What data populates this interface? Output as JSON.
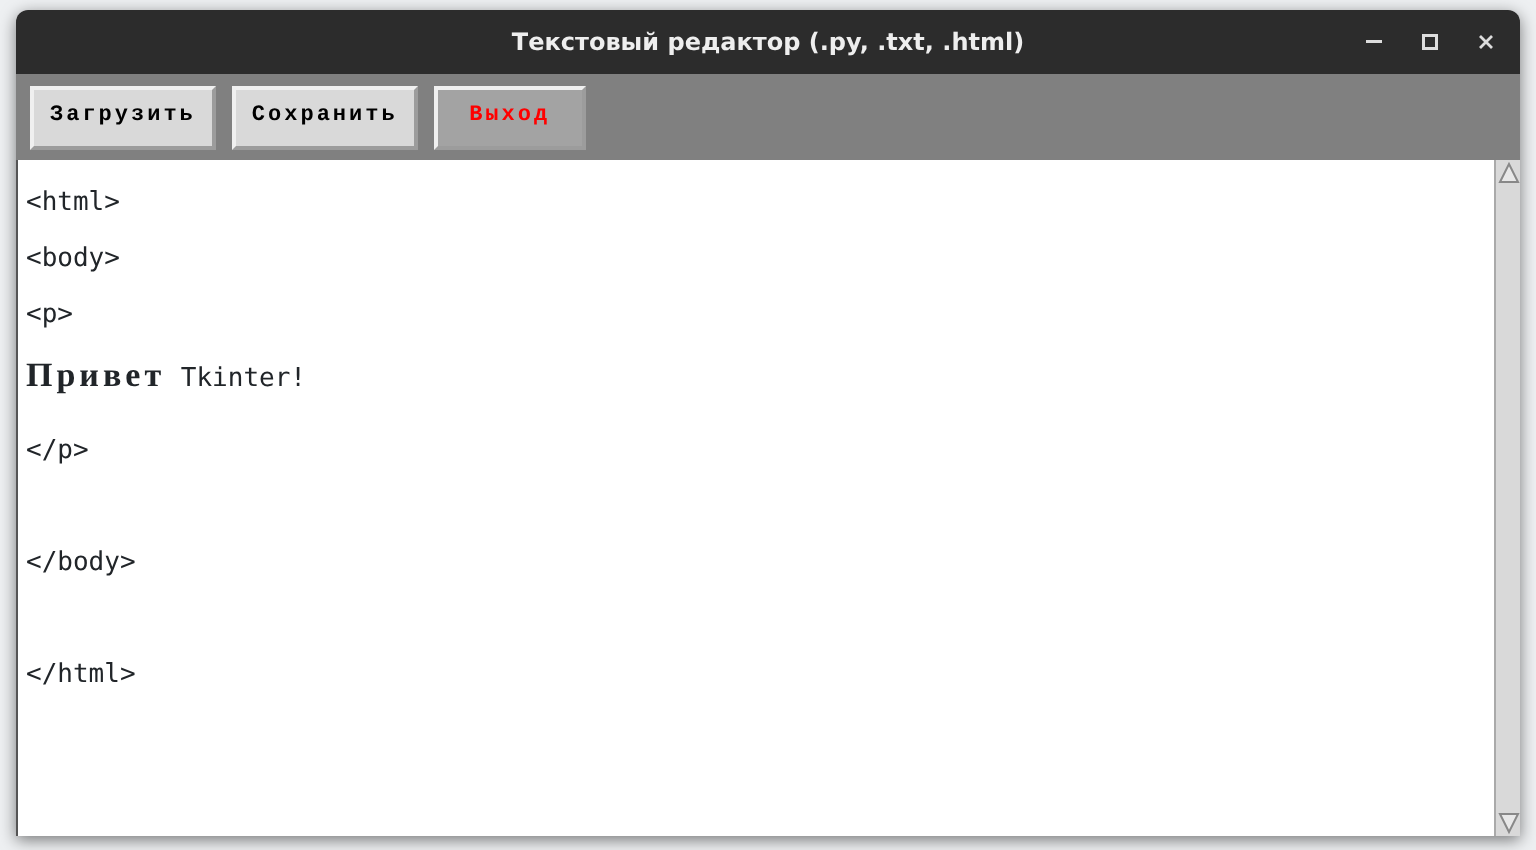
{
  "window": {
    "title": "Текстовый редактор (.py, .txt, .html)"
  },
  "toolbar": {
    "buttons": [
      {
        "label": "Загрузить",
        "kind": "normal"
      },
      {
        "label": "Сохранить",
        "kind": "normal"
      },
      {
        "label": "Выход",
        "kind": "exit"
      }
    ]
  },
  "editor": {
    "lines": [
      {
        "kind": "text",
        "text": "<html>"
      },
      {
        "kind": "text",
        "text": "<body>"
      },
      {
        "kind": "text",
        "text": "<p>"
      },
      {
        "kind": "text",
        "text": "**Привет** Tkinter!"
      },
      {
        "kind": "text",
        "text": "</p>"
      },
      {
        "kind": "blank"
      },
      {
        "kind": "text",
        "text": "</body>"
      },
      {
        "kind": "blank"
      },
      {
        "kind": "text",
        "text": "</html>"
      }
    ]
  }
}
